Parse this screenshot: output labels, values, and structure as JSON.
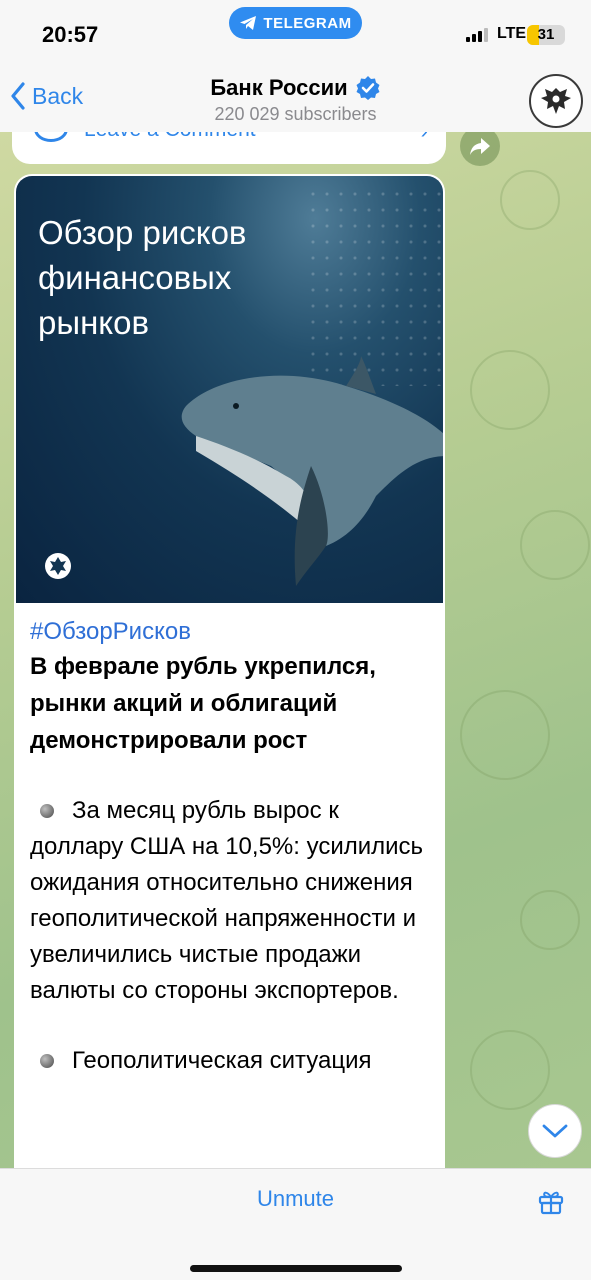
{
  "status_bar": {
    "time": "20:57",
    "app_pill": "TELEGRAM",
    "network": "LTE",
    "battery": "31",
    "battery_level": 0.31
  },
  "header": {
    "back_label": "Back",
    "channel_name": "Банк России",
    "subscribers": "220 029 subscribers"
  },
  "previous_message": {
    "comment_label": "Leave a Comment"
  },
  "post": {
    "image_headline": [
      "Обзор рисков",
      "финансовых",
      "рынков"
    ],
    "hashtag": "#ОбзорРисков",
    "lead": "В феврале рубль укрепился, рынки акций и облигаций демонстрировали рост",
    "bullet_1": "За месяц рубль вырос к доллару США на 10,5%: усилились ожидания относительно снижения геополитической напряженности и увеличились чистые продажи валюты со стороны экспортеров.",
    "bullet_2": "Геополитическая ситуация"
  },
  "bottom_bar": {
    "unmute_label": "Unmute"
  },
  "colors": {
    "accent": "#2f86e9",
    "telegram_pill": "#2f8cf0",
    "hashtag": "#2f6fd6",
    "battery": "#f7c600"
  }
}
